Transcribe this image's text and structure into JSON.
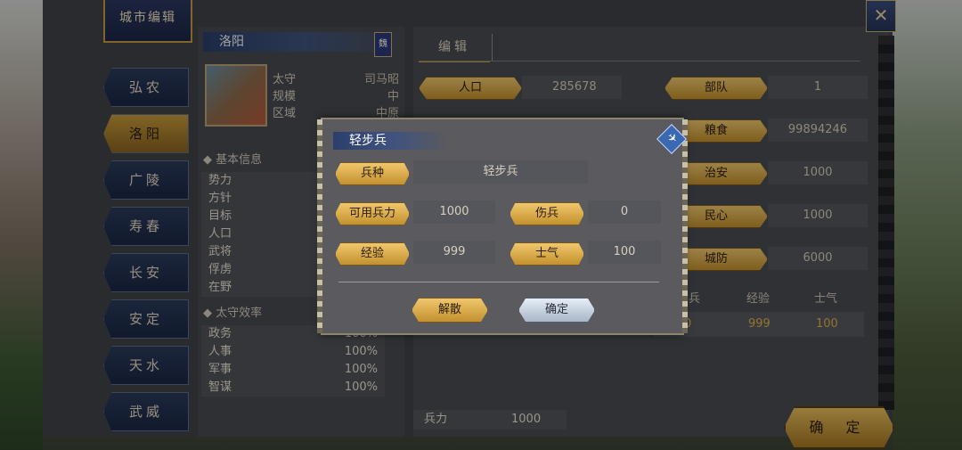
{
  "window": {
    "title": "城市编辑",
    "close_glyph": "✕"
  },
  "sidebar": {
    "items": [
      {
        "label": "弘农"
      },
      {
        "label": "洛阳"
      },
      {
        "label": "广陵"
      },
      {
        "label": "寿春"
      },
      {
        "label": "长安"
      },
      {
        "label": "安定"
      },
      {
        "label": "天水"
      },
      {
        "label": "武威"
      }
    ],
    "active": "洛阳"
  },
  "city": {
    "name": "洛阳",
    "faction_badge": "魏",
    "governor_label": "太守",
    "governor": "司马昭",
    "scale_label": "规模",
    "scale": "中",
    "region_label": "区域",
    "region": "中原"
  },
  "basic_info": {
    "title": "基本信息",
    "rows": [
      {
        "label": "势力"
      },
      {
        "label": "方针"
      },
      {
        "label": "目标"
      },
      {
        "label": "人口"
      },
      {
        "label": "武将"
      },
      {
        "label": "俘虏"
      },
      {
        "label": "在野"
      }
    ]
  },
  "efficiency": {
    "title": "太守效率",
    "rows": [
      {
        "label": "政务",
        "value": "100%"
      },
      {
        "label": "人事",
        "value": "100%"
      },
      {
        "label": "军事",
        "value": "100%"
      },
      {
        "label": "智谋",
        "value": "100%"
      }
    ]
  },
  "editor": {
    "tab": "编辑",
    "fields": {
      "population": {
        "label": "人口",
        "value": "285678"
      },
      "troops": {
        "label": "部队",
        "value": "1"
      },
      "food": {
        "label": "粮食",
        "value": "99894246"
      },
      "order": {
        "label": "治安",
        "value": "1000"
      },
      "loyalty": {
        "label": "民心",
        "value": "1000"
      },
      "defense": {
        "label": "城防",
        "value": "6000"
      }
    },
    "table": {
      "headers": [
        "伤兵",
        "经验",
        "士气"
      ],
      "row": [
        "0",
        "999",
        "100"
      ]
    },
    "bottom": {
      "label": "兵力",
      "value": "1000"
    },
    "confirm_label": "确 定"
  },
  "modal": {
    "title": "轻步兵",
    "pin_glyph": "✈",
    "type_label": "兵种",
    "type_value": "轻步兵",
    "troops_label": "可用兵力",
    "troops_value": "1000",
    "wounded_label": "伤兵",
    "wounded_value": "0",
    "exp_label": "经验",
    "exp_value": "999",
    "morale_label": "士气",
    "morale_value": "100",
    "disband_label": "解散",
    "confirm_label": "确定"
  }
}
